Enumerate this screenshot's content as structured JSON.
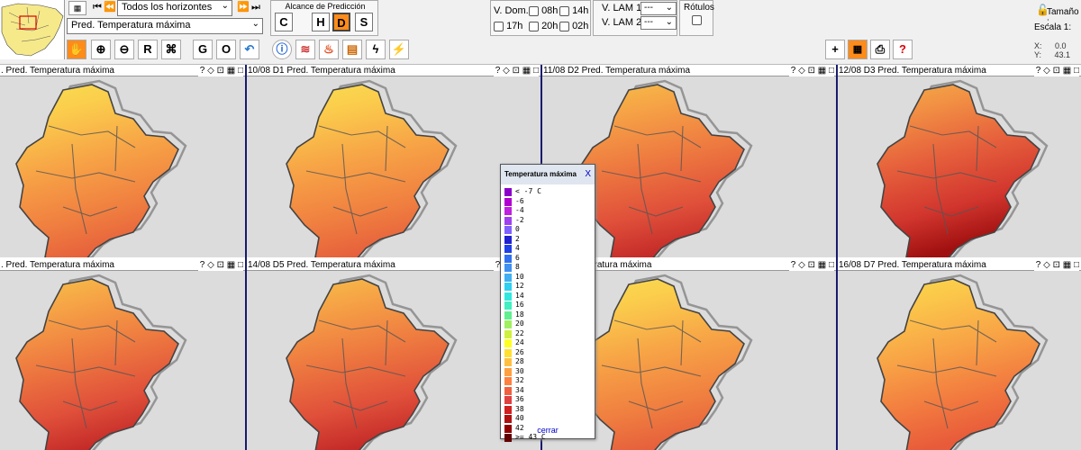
{
  "nav": {
    "horizon_select": "Todos los horizontes",
    "variable_select": "Pred. Temperatura máxima"
  },
  "alcance": {
    "title": "Alcance de Predicción",
    "buttons": [
      "C",
      "H",
      "D",
      "S"
    ],
    "active": "D"
  },
  "vdom": {
    "label": "V. Dom.",
    "options": [
      "08h",
      "14h",
      "17h",
      "20h",
      "02h"
    ]
  },
  "vlam": {
    "lam1_label": "V. LAM 1",
    "lam2_label": "V. LAM 2",
    "lam1_value": "---",
    "lam2_value": "---"
  },
  "rotulos": {
    "label": "Rótulos"
  },
  "right_info": {
    "tamano": "Tamaño :",
    "escala": "Escala 1:",
    "x_label": "X:",
    "x_value": "0.0",
    "y_label": "Y:",
    "y_value": "43.1"
  },
  "toolbar": {
    "letters": [
      "R",
      "G",
      "O"
    ]
  },
  "panels": [
    {
      "title": ". Pred. Temperatura máxima",
      "level": 1
    },
    {
      "title": "10/08 D1 Pred. Temperatura máxima",
      "level": 1
    },
    {
      "title": "11/08 D2 Pred. Temperatura máxima",
      "level": 2
    },
    {
      "title": "12/08 D3 Pred. Temperatura máxima",
      "level": 3
    },
    {
      "title": ". Pred. Temperatura máxima",
      "level": 2
    },
    {
      "title": "14/08 D5 Pred. Temperatura máxima",
      "level": 2
    },
    {
      "title": "Pred. Temperatura máxima",
      "level": 1
    },
    {
      "title": "16/08 D7 Pred. Temperatura máxima",
      "level": 0
    }
  ],
  "panel_icons": "? ◇ ⊡ ▦ □",
  "legend": {
    "title": "Temperatura máxima",
    "close": "X",
    "footer": "cerrar",
    "rows": [
      {
        "label": "<  -7  C",
        "color": "#8a00c8"
      },
      {
        "label": "-6",
        "color": "#b000d0"
      },
      {
        "label": "-4",
        "color": "#c020e0"
      },
      {
        "label": "-2",
        "color": "#a040f0"
      },
      {
        "label": "0",
        "color": "#8060ff"
      },
      {
        "label": "2",
        "color": "#2020d0"
      },
      {
        "label": "4",
        "color": "#2040e8"
      },
      {
        "label": "6",
        "color": "#3070f0"
      },
      {
        "label": "8",
        "color": "#4090f0"
      },
      {
        "label": "10",
        "color": "#40b0f0"
      },
      {
        "label": "12",
        "color": "#30d0f0"
      },
      {
        "label": "14",
        "color": "#30e8e0"
      },
      {
        "label": "16",
        "color": "#40f0c0"
      },
      {
        "label": "18",
        "color": "#60f090"
      },
      {
        "label": "20",
        "color": "#a0f060"
      },
      {
        "label": "22",
        "color": "#d0f040"
      },
      {
        "label": "24",
        "color": "#ffff20"
      },
      {
        "label": "26",
        "color": "#ffe030"
      },
      {
        "label": "28",
        "color": "#ffc040"
      },
      {
        "label": "30",
        "color": "#ffa040"
      },
      {
        "label": "32",
        "color": "#ff8040"
      },
      {
        "label": "34",
        "color": "#f06040"
      },
      {
        "label": "36",
        "color": "#e04040"
      },
      {
        "label": "38",
        "color": "#d02020"
      },
      {
        "label": "40",
        "color": "#b01010"
      },
      {
        "label": "42",
        "color": "#900000"
      },
      {
        "label": ">= 43  C",
        "color": "#600000"
      }
    ]
  }
}
